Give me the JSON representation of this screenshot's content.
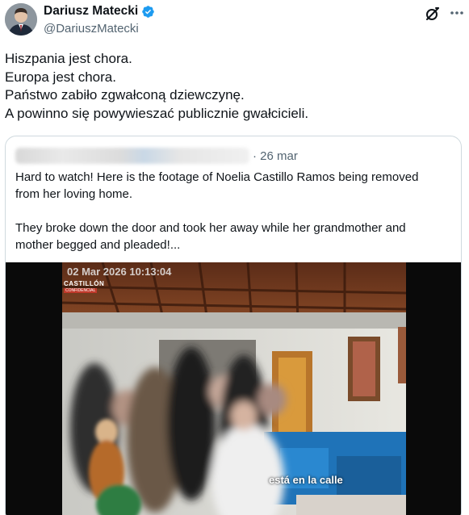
{
  "author": {
    "display_name": "Dariusz Matecki",
    "handle": "@DariuszMatecki",
    "verified": true,
    "verified_color": "#1d9bf0"
  },
  "actions": {
    "grok_icon": "grok-icon",
    "more_icon": "more-icon"
  },
  "tweet": {
    "lines": [
      "Hiszpania jest chora.",
      "Europa jest chora.",
      "Państwo zabiło zgwałconą dziewczynę.",
      "A powinno się powywieszać publicznie gwałcicieli."
    ]
  },
  "quote": {
    "date": "· 26 mar",
    "paragraph1": [
      "Hard to watch! Here is the footage of Noelia Castillo Ramos being removed",
      "from her loving home."
    ],
    "paragraph2": [
      "They broke down the door and took her away while her grandmother and",
      "mother begged and pleaded!..."
    ],
    "video": {
      "timestamp": "02 Mar 2026 10:13:04",
      "logo": "CASTILLÓN",
      "logo_sub": "CONFIDENCIAL",
      "subtitle": "está en la calle"
    }
  },
  "colors": {
    "text": "#0f1419",
    "secondary": "#536471",
    "border": "#cfd9de"
  }
}
